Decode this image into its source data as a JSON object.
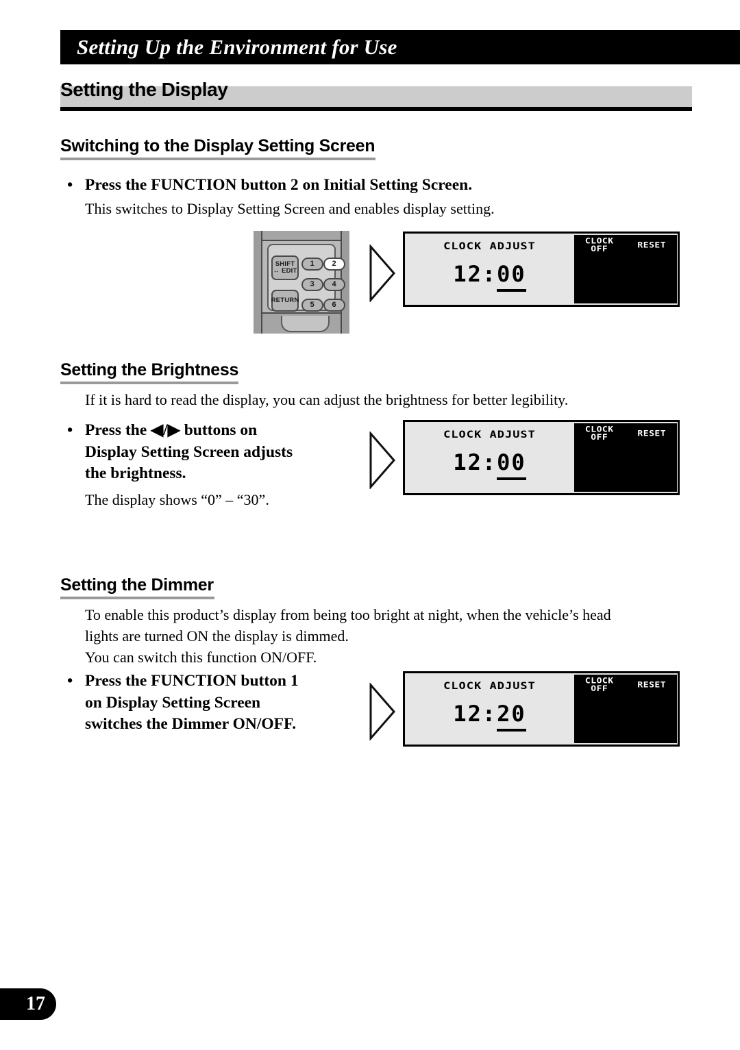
{
  "chapter": {
    "title": "Setting Up the Environment for Use"
  },
  "section": {
    "title": "Setting the Display"
  },
  "subsections": [
    {
      "heading": "Switching to the Display Setting Screen",
      "bullet": "Press the FUNCTION button 2 on Initial Setting Screen.",
      "note": "This switches to Display Setting Screen and enables display setting."
    },
    {
      "heading": "Setting the Brightness",
      "intro": "If it is hard to read the display, you can adjust the brightness for better legibility.",
      "bullet_line1": "Press the ◀/▶ buttons on",
      "bullet_line2": "Display Setting Screen adjusts",
      "bullet_line3": "the brightness.",
      "note": "The display shows “0” – “30”."
    },
    {
      "heading": "Setting the Dimmer",
      "intro_line1": "To enable this product’s display from being too bright at night, when the vehicle’s head",
      "intro_line2": "lights are turned ON the display is dimmed.",
      "intro_line3": "You can switch this function ON/OFF.",
      "bullet_line1": "Press the FUNCTION button 1",
      "bullet_line2": "on Display Setting Screen",
      "bullet_line3": "switches the Dimmer ON/OFF."
    }
  ],
  "remote": {
    "keys": {
      "shift": "SHIFT",
      "shift_sub": "↔ EDIT",
      "return": "RETURN",
      "n1": "1",
      "n2": "2",
      "n3": "3",
      "n4": "4",
      "n5": "5",
      "n6": "6"
    },
    "highlighted_key": "2"
  },
  "lcd_screens": [
    {
      "title": "CLOCK ADJUST",
      "time_prefix": "12:",
      "time_selected": "00",
      "buttons": [
        "CLOCK OFF",
        "RESET",
        "",
        "",
        "",
        ""
      ]
    },
    {
      "title": "CLOCK ADJUST",
      "time_prefix": "12:",
      "time_selected": "00",
      "buttons": [
        "CLOCK OFF",
        "RESET",
        "",
        "",
        "",
        ""
      ]
    },
    {
      "title": "CLOCK ADJUST",
      "time_prefix": "12:",
      "time_selected": "20",
      "buttons": [
        "CLOCK OFF",
        "RESET",
        "",
        "",
        "",
        ""
      ]
    }
  ],
  "footer": {
    "page_number": "17"
  }
}
